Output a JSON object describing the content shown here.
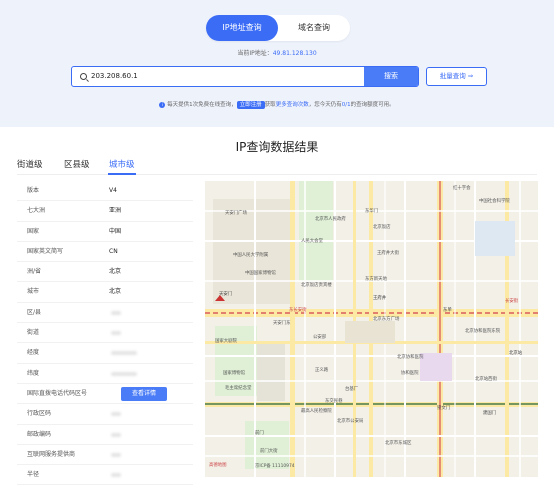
{
  "toggle": {
    "ip_label": "IP地址查询",
    "domain_label": "域名查询"
  },
  "current_ip": {
    "label": "当前IP地址：",
    "value": "49.81.128.130"
  },
  "search": {
    "value": "203.208.60.1",
    "button": "搜索",
    "batch": "批量查询 ⇒"
  },
  "notice": {
    "p1": "每天提供1次免费在线查询，",
    "register": "立即注册",
    "p2": "获取",
    "more": "更多查询次数",
    "p3": "，您今天仍有",
    "count": "0/1",
    "p4": "的查询额度可用。"
  },
  "result_title": "IP查询数据结果",
  "tabs": [
    "街道级",
    "区县级",
    "城市级"
  ],
  "info_rows": [
    {
      "k": "版本",
      "v": "V4"
    },
    {
      "k": "七大洲",
      "v": "亚洲"
    },
    {
      "k": "国家",
      "v": "中国"
    },
    {
      "k": "国家英文简写",
      "v": "CN"
    },
    {
      "k": "洲/省",
      "v": "北京"
    },
    {
      "k": "城市",
      "v": "北京"
    },
    {
      "k": "区/县",
      "v": ""
    },
    {
      "k": "街道",
      "v": ""
    },
    {
      "k": "经度",
      "v": ""
    },
    {
      "k": "纬度",
      "v": ""
    },
    {
      "k": "国际直拨电话代码区号",
      "v": ""
    },
    {
      "k": "行政区码",
      "v": ""
    },
    {
      "k": "邮政编码",
      "v": ""
    },
    {
      "k": "互联网服务提供商",
      "v": ""
    },
    {
      "k": "半径",
      "v": ""
    }
  ],
  "detail_button": "查看详情",
  "map_labels": {
    "a1": "天安门广场",
    "a2": "天安门",
    "a3": "天安门东",
    "a4": "正义路",
    "a5": "王府井",
    "a6": "东单",
    "a7": "北京站",
    "a8": "前门",
    "a9": "中国人民大学附属",
    "a10": "国家博物馆",
    "a11": "人民大会堂",
    "a12": "北京协和医院",
    "a13": "建国门",
    "a14": "东华门",
    "a15": "北京饭店",
    "a16": "东方新天地",
    "a17": "长安街",
    "a18": "崇文门",
    "a19": "红十字会",
    "a20": "东长安街",
    "a21": "毛主席纪念堂",
    "a22": "北京市公安局",
    "a23": "协和医院",
    "a24": "公安部",
    "a25": "最高人民检察院",
    "a26": "北京饭店贵宾楼",
    "a27": "国家大剧院",
    "a28": "台基厂",
    "a29": "东交民巷",
    "a30": "北京站西街",
    "a31": "前门大街",
    "a32": "北京市人民政府",
    "a33": "中国国家博物馆",
    "a34": "北京东方广场",
    "a35": "中国社会科学院",
    "a36": "京ICP备 11110974",
    "a37": "高德地图",
    "a38": "北京协和医院东院",
    "a39": "王府井大街",
    "a40": "北京市东城区"
  }
}
